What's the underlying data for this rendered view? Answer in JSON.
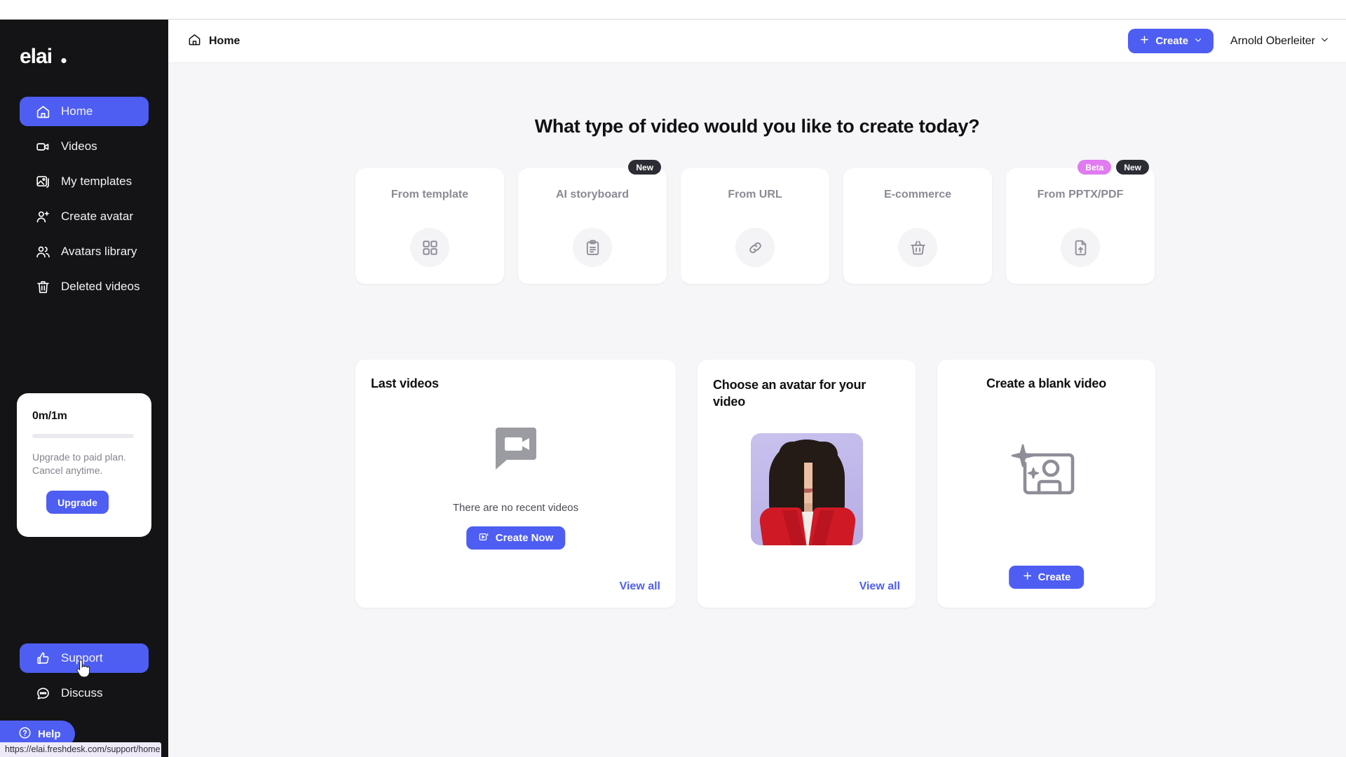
{
  "browser": {
    "status_url": "https://elai.freshdesk.com/support/home"
  },
  "colors": {
    "accent": "#4e5ef2",
    "sidebar_bg": "#141416",
    "content_bg": "#f6f6f8",
    "badge_dark": "#2c2c34",
    "badge_beta": "#e07bf0",
    "link": "#4e5ef2"
  },
  "sidebar": {
    "brand": "elai.",
    "items": [
      {
        "label": "Home",
        "icon": "home-icon",
        "active": true
      },
      {
        "label": "Videos",
        "icon": "video-camera-icon",
        "active": false
      },
      {
        "label": "My templates",
        "icon": "image-stack-icon",
        "active": false
      },
      {
        "label": "Create avatar",
        "icon": "user-plus-icon",
        "active": false
      },
      {
        "label": "Avatars library",
        "icon": "users-icon",
        "active": false
      },
      {
        "label": "Deleted videos",
        "icon": "trash-icon",
        "active": false
      }
    ],
    "upgrade_card": {
      "usage": "0m/1m",
      "progress_percent": 0,
      "description": "Upgrade to paid plan. Cancel anytime.",
      "button_label": "Upgrade"
    },
    "bottom_items": [
      {
        "label": "Support",
        "icon": "thumbs-up-icon",
        "active": true
      },
      {
        "label": "Discuss",
        "icon": "chat-bubble-icon",
        "active": false
      }
    ],
    "help_button": {
      "label": "Help",
      "icon": "question-circle-icon"
    }
  },
  "topbar": {
    "breadcrumb": "Home",
    "breadcrumb_icon": "home-icon",
    "create_button": "Create",
    "create_icon": "plus-icon",
    "create_chevron": "chevron-down-icon",
    "user_name": "Arnold Oberleiter",
    "user_chevron": "chevron-down-icon"
  },
  "main": {
    "heading": "What type of video would you like to create today?",
    "type_cards": [
      {
        "title": "From template",
        "icon": "grid-icon",
        "badges": []
      },
      {
        "title": "AI storyboard",
        "icon": "clipboard-icon",
        "badges": [
          {
            "label": "New",
            "style": "dark"
          }
        ]
      },
      {
        "title": "From URL",
        "icon": "link-icon",
        "badges": []
      },
      {
        "title": "E-commerce",
        "icon": "basket-icon",
        "badges": []
      },
      {
        "title": "From PPTX/PDF",
        "icon": "file-upload-icon",
        "badges": [
          {
            "label": "Beta",
            "style": "beta"
          },
          {
            "label": "New",
            "style": "dark"
          }
        ]
      }
    ],
    "last_videos": {
      "title": "Last videos",
      "empty_icon": "video-placeholder-icon",
      "empty_text": "There are no recent videos",
      "create_button": "Create Now",
      "create_icon": "video-play-icon",
      "view_all": "View all"
    },
    "avatar_panel": {
      "title": "Choose an avatar for your video",
      "avatar_alt": "avatar-thumbnail",
      "view_all": "View all"
    },
    "blank_panel": {
      "title": "Create a blank video",
      "icon": "image-sparkle-icon",
      "create_button": "Create",
      "create_icon": "plus-icon"
    }
  }
}
